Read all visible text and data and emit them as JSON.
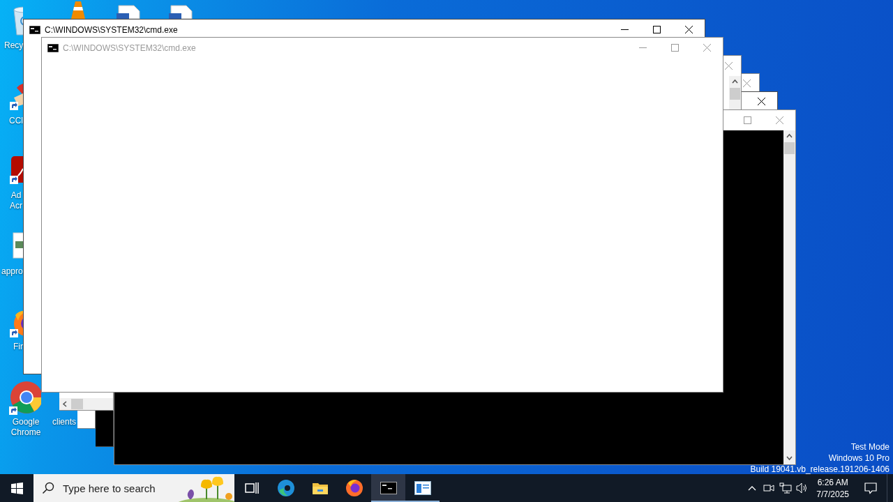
{
  "desktop_icons": [
    {
      "kind": "recycle-bin",
      "label": "Recy"
    },
    {
      "kind": "cone"
    },
    {
      "kind": "document"
    },
    {
      "kind": "document"
    },
    {
      "kind": "cleaner",
      "label": "CCl"
    },
    {
      "kind": "acrobat",
      "label": "Ad Acr"
    },
    {
      "kind": "image-file",
      "label": "appro"
    },
    {
      "kind": "firefox",
      "label": "Fir"
    },
    {
      "kind": "chrome",
      "label": "Google Chrome"
    },
    {
      "label": "clients"
    }
  ],
  "windows": [
    {
      "active": false,
      "controls": [
        {
          "kind": "close"
        }
      ]
    },
    {
      "active": true,
      "controls": [
        {
          "kind": "close"
        }
      ],
      "console": true
    },
    {
      "active": false,
      "controls": [
        {
          "kind": "close"
        }
      ],
      "vertical_scrollbar": true,
      "horizontal_scrollbar": true
    },
    {
      "active": false,
      "controls": [
        {
          "kind": "maximize"
        },
        {
          "kind": "close"
        }
      ],
      "console": true,
      "vertical_scrollbar": true
    },
    {
      "title": "C:\\WINDOWS\\SYSTEM32\\cmd.exe",
      "active": true,
      "controls": [
        {
          "kind": "minimize"
        },
        {
          "kind": "maximize"
        },
        {
          "kind": "close"
        }
      ]
    },
    {
      "title": "C:\\WINDOWS\\SYSTEM32\\cmd.exe",
      "active": false,
      "controls": [
        {
          "kind": "minimize"
        },
        {
          "kind": "maximize"
        },
        {
          "kind": "close"
        }
      ]
    }
  ],
  "os_watermark": [
    "Test Mode",
    "Windows 10 Pro",
    "Build 19041.vb_release.191206-1406"
  ],
  "taskbar": {
    "search": {
      "placeholder": "Type here to search"
    },
    "apps": [
      {
        "kind": "task-view",
        "selected": false,
        "running": false
      },
      {
        "kind": "edge",
        "selected": false,
        "running": false
      },
      {
        "kind": "explorer",
        "selected": false,
        "running": false
      },
      {
        "kind": "firefox",
        "selected": false,
        "running": false
      },
      {
        "kind": "cmd",
        "selected": true,
        "running": true
      },
      {
        "kind": "window",
        "selected": false,
        "running": true
      }
    ],
    "clock": {
      "time": "6:26 AM",
      "date": "7/7/2025"
    }
  }
}
